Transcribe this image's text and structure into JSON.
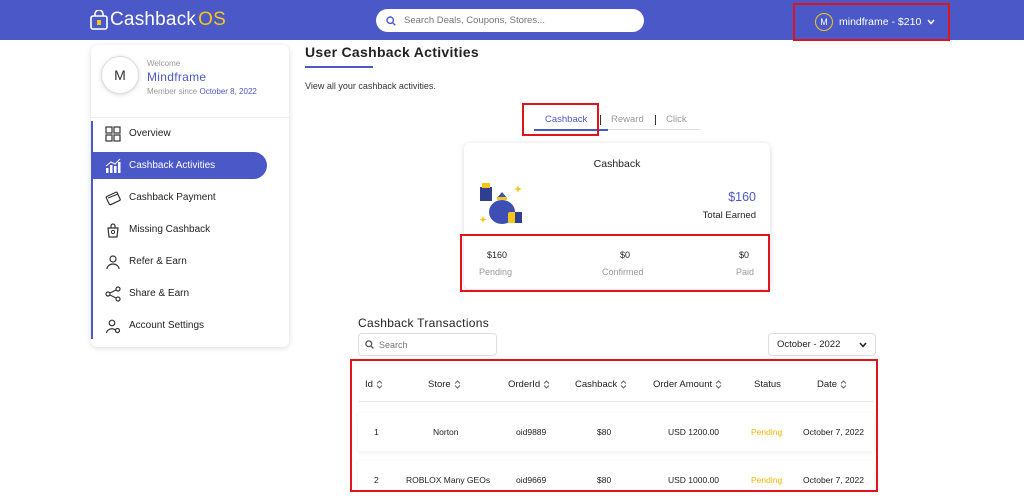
{
  "header": {
    "logo_main": "Cashback",
    "logo_accent": "OS",
    "search_placeholder": "Search Deals, Coupons, Stores...",
    "user_initial": "M",
    "user_label": "mindframe - $210"
  },
  "profile": {
    "initial": "M",
    "welcome": "Welcome",
    "name": "Mindframe",
    "member_since_label": "Member since",
    "member_since_date": "October 8, 2022"
  },
  "sidebar": {
    "items": [
      {
        "label": "Overview",
        "icon": "grid-icon"
      },
      {
        "label": "Cashback Activities",
        "icon": "chart-icon"
      },
      {
        "label": "Cashback Payment",
        "icon": "payment-icon"
      },
      {
        "label": "Missing Cashback",
        "icon": "bag-search-icon"
      },
      {
        "label": "Refer & Earn",
        "icon": "person-icon"
      },
      {
        "label": "Share & Earn",
        "icon": "share-icon"
      },
      {
        "label": "Account Settings",
        "icon": "gear-user-icon"
      }
    ],
    "active_index": 1
  },
  "main": {
    "title": "User Cashback Activities",
    "subtitle": "View all your cashback activities.",
    "tabs": [
      {
        "label": "Cashback",
        "active": true
      },
      {
        "label": "Reward",
        "active": false
      },
      {
        "label": "Click",
        "active": false
      }
    ]
  },
  "summary": {
    "title": "Cashback",
    "total_value": "$160",
    "total_label": "Total Earned",
    "pending_value": "$160",
    "pending_label": "Pending",
    "confirmed_value": "$0",
    "confirmed_label": "Confirmed",
    "paid_value": "$0",
    "paid_label": "Paid"
  },
  "transactions": {
    "title": "Cashback Transactions",
    "search_placeholder": "Search",
    "month": "October - 2022",
    "columns": [
      "Id",
      "Store",
      "OrderId",
      "Cashback",
      "Order Amount",
      "Status",
      "Date"
    ],
    "rows": [
      {
        "id": "1",
        "store": "Norton",
        "order_id": "oid9889",
        "cashback": "$80",
        "amount": "USD 1200.00",
        "status": "Pending",
        "date": "October 7, 2022"
      },
      {
        "id": "2",
        "store": "ROBLOX Many GEOs",
        "order_id": "oid9669",
        "cashback": "$80",
        "amount": "USD 1000.00",
        "status": "Pending",
        "date": "October 7, 2022"
      }
    ]
  },
  "colors": {
    "brand": "#4b58c7",
    "accent": "#f5c518",
    "pending": "#f5b400",
    "highlight_box": "#e0141e"
  }
}
